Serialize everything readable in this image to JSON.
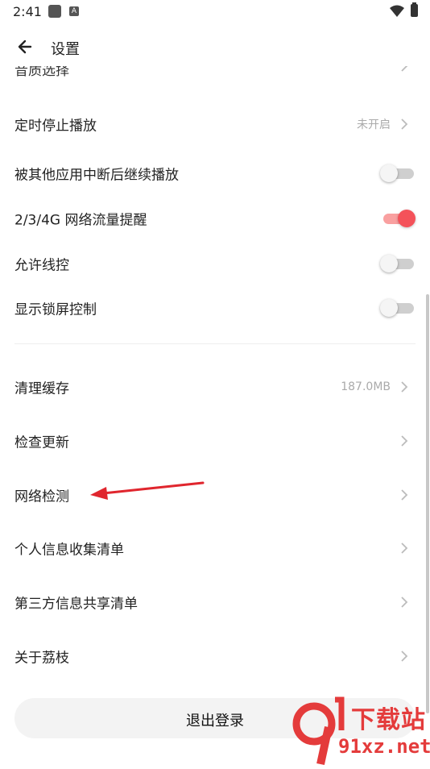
{
  "status_bar": {
    "time": "2:41",
    "notif_icon_letter": "A"
  },
  "header": {
    "title": "设置"
  },
  "clipped_row": {
    "label": "音质选择"
  },
  "rows_a": [
    {
      "label": "定时停止播放",
      "value": "未开启",
      "type": "link"
    },
    {
      "label": "被其他应用中断后继续播放",
      "type": "toggle",
      "on": false
    },
    {
      "label": "2/3/4G 网络流量提醒",
      "type": "toggle",
      "on": true
    },
    {
      "label": "允许线控",
      "type": "toggle",
      "on": false
    },
    {
      "label": "显示锁屏控制",
      "type": "toggle",
      "on": false
    }
  ],
  "rows_b": [
    {
      "label": "清理缓存",
      "value": "187.0MB"
    },
    {
      "label": "检查更新"
    },
    {
      "label": "网络检测"
    },
    {
      "label": "个人信息收集清单"
    },
    {
      "label": "第三方信息共享清单"
    },
    {
      "label": "关于荔枝"
    }
  ],
  "logout_label": "退出登录",
  "watermark": {
    "brand": "下载站",
    "site": "91xz.net"
  },
  "colors": {
    "accent": "#f4525a",
    "arrow": "#e0262e"
  }
}
